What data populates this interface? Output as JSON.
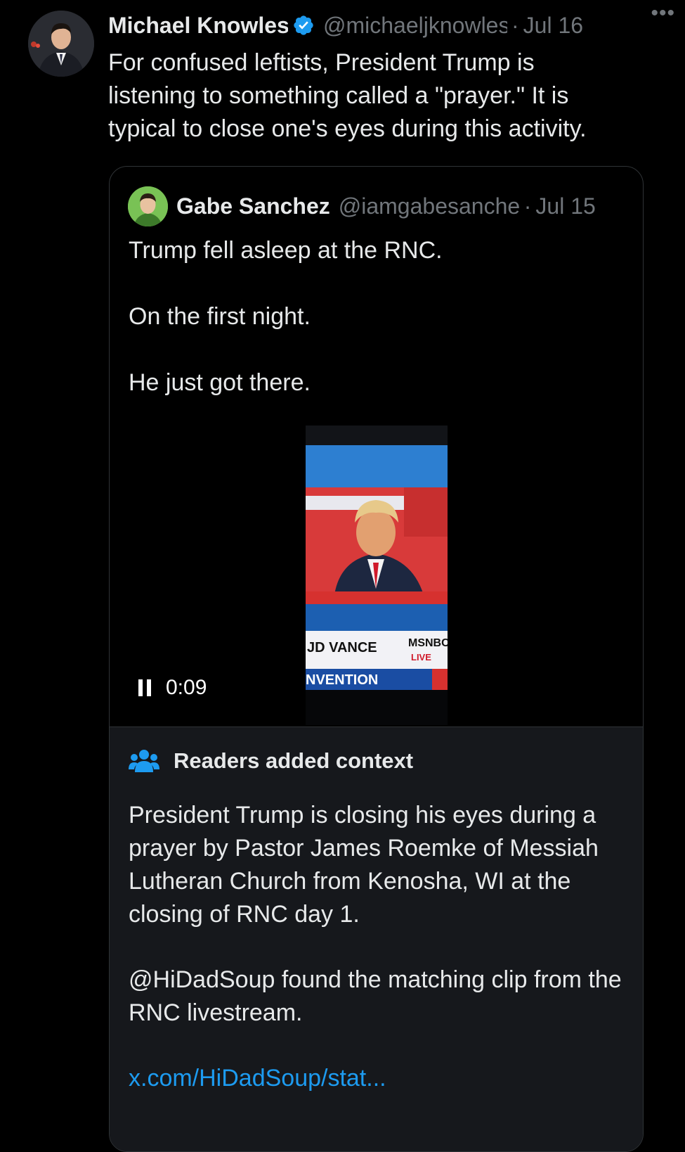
{
  "tweet": {
    "author_name": "Michael Knowles",
    "handle": "@michaeljknowles",
    "separator": "·",
    "date": "Jul 16",
    "more_label": "•••",
    "text_lines": [
      "For confused leftists, President Trump is",
      "listening to something called a \"prayer.\" It is",
      "typical to close one's eyes during this activity."
    ]
  },
  "quote": {
    "author_name": "Gabe Sanchez",
    "handle": "@iamgabesanchez",
    "separator": "·",
    "date": "Jul 15",
    "text_lines": [
      "Trump fell asleep at the RNC.",
      "On the first night.",
      "He just got there."
    ],
    "video": {
      "timestamp": "0:09",
      "lower_third": "JD VANCE",
      "network": "MSNBC",
      "live": "LIVE",
      "banner": "NVENTION"
    }
  },
  "context": {
    "title": "Readers added context",
    "paragraph1": "President Trump is closing his eyes during a prayer by Pastor James Roemke of Messiah Lutheran Church from Kenosha, WI at the closing of RNC day 1.",
    "paragraph2": "@HiDadSoup found the matching clip from the RNC livestream.",
    "link": "x.com/HiDadSoup/stat..."
  },
  "colors": {
    "background": "#000000",
    "text": "#e7e9ea",
    "muted": "#71767b",
    "accent": "#1d9bf0",
    "card_border": "#2f3336",
    "context_bg": "#16181c"
  },
  "icons": {
    "verified": "verified-badge-icon",
    "more": "more-icon",
    "pause": "pause-icon",
    "context": "people-icon"
  }
}
